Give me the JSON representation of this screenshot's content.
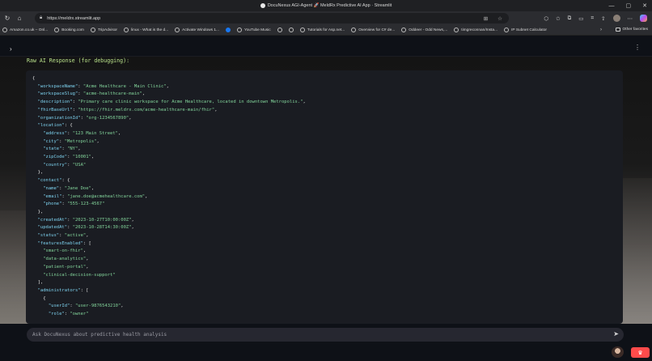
{
  "window": {
    "title": "DocuNexus AGI-Agent 🚀 MeldRx Predictive AI App · Streamlit",
    "controls": [
      "—",
      "▢",
      "✕"
    ]
  },
  "browser": {
    "url": "https://meldrx.streamlit.app",
    "bookmarks": [
      {
        "label": "Amazon.co.uk – Onl...",
        "icon": "amazon-icon"
      },
      {
        "label": "Booking.com",
        "icon": "globe-icon"
      },
      {
        "label": "TripAdvisor",
        "icon": "globe-icon"
      },
      {
        "label": "linux - What is the d...",
        "icon": "globe-icon"
      },
      {
        "label": "Activate Windows 1...",
        "icon": "globe-icon"
      },
      {
        "label": "",
        "icon": "facebook-icon"
      },
      {
        "label": "YouTube Music",
        "icon": "globe-icon"
      },
      {
        "label": "",
        "icon": "globe-icon"
      },
      {
        "label": "",
        "icon": "globe-icon"
      },
      {
        "label": "Tutorials for Asp.net...",
        "icon": "globe-icon"
      },
      {
        "label": "Overview for C# de...",
        "icon": "globe-icon"
      },
      {
        "label": "Oddeer - Odd News,...",
        "icon": "globe-icon"
      },
      {
        "label": "timgreconnan/Insta...",
        "icon": "globe-icon"
      },
      {
        "label": "IP Subnet Calculator",
        "icon": "globe-icon"
      }
    ],
    "other_favorites": "Other favorites"
  },
  "app": {
    "debug_label": "Raw AI Response (for debugging):",
    "chat_placeholder": "Ask DocuNexus about predictive health analysis",
    "json_lines": [
      {
        "indent": 0,
        "key": null,
        "value": "{",
        "punct": ""
      },
      {
        "indent": 1,
        "key": "\"workspaceName\"",
        "value": "\"Acme Healthcare - Main Clinic\"",
        "punct": ","
      },
      {
        "indent": 1,
        "key": "\"workspaceSlug\"",
        "value": "\"acme-healthcare-main\"",
        "punct": ","
      },
      {
        "indent": 1,
        "key": "\"description\"",
        "value": "\"Primary care clinic workspace for Acme Healthcare, located in downtown Metropolis.\"",
        "punct": ","
      },
      {
        "indent": 1,
        "key": "\"fhirBaseUrl\"",
        "value": "\"https://fhir.meldrx.com/acme-healthcare-main/fhir\"",
        "punct": ","
      },
      {
        "indent": 1,
        "key": "\"organizationId\"",
        "value": "\"org-1234567890\"",
        "punct": ","
      },
      {
        "indent": 1,
        "key": "\"location\"",
        "value": "{",
        "punct": ""
      },
      {
        "indent": 2,
        "key": "\"address\"",
        "value": "\"123 Main Street\"",
        "punct": ","
      },
      {
        "indent": 2,
        "key": "\"city\"",
        "value": "\"Metropolis\"",
        "punct": ","
      },
      {
        "indent": 2,
        "key": "\"state\"",
        "value": "\"NY\"",
        "punct": ","
      },
      {
        "indent": 2,
        "key": "\"zipCode\"",
        "value": "\"10001\"",
        "punct": ","
      },
      {
        "indent": 2,
        "key": "\"country\"",
        "value": "\"USA\"",
        "punct": ""
      },
      {
        "indent": 1,
        "key": null,
        "value": "}",
        "punct": ","
      },
      {
        "indent": 1,
        "key": "\"contact\"",
        "value": "{",
        "punct": ""
      },
      {
        "indent": 2,
        "key": "\"name\"",
        "value": "\"Jane Doe\"",
        "punct": ","
      },
      {
        "indent": 2,
        "key": "\"email\"",
        "value": "\"jane.doe@acmehealthcare.com\"",
        "punct": ","
      },
      {
        "indent": 2,
        "key": "\"phone\"",
        "value": "\"555-123-4567\"",
        "punct": ""
      },
      {
        "indent": 1,
        "key": null,
        "value": "}",
        "punct": ","
      },
      {
        "indent": 1,
        "key": "\"createdAt\"",
        "value": "\"2023-10-27T10:00:00Z\"",
        "punct": ","
      },
      {
        "indent": 1,
        "key": "\"updatedAt\"",
        "value": "\"2023-10-28T14:30:00Z\"",
        "punct": ","
      },
      {
        "indent": 1,
        "key": "\"status\"",
        "value": "\"active\"",
        "punct": ","
      },
      {
        "indent": 1,
        "key": "\"featuresEnabled\"",
        "value": "[",
        "punct": ""
      },
      {
        "indent": 2,
        "key": null,
        "value": "\"smart-on-fhir\"",
        "punct": ","
      },
      {
        "indent": 2,
        "key": null,
        "value": "\"data-analytics\"",
        "punct": ","
      },
      {
        "indent": 2,
        "key": null,
        "value": "\"patient-portal\"",
        "punct": ","
      },
      {
        "indent": 2,
        "key": null,
        "value": "\"clinical-decision-support\"",
        "punct": ""
      },
      {
        "indent": 1,
        "key": null,
        "value": "]",
        "punct": ","
      },
      {
        "indent": 1,
        "key": "\"administrators\"",
        "value": "[",
        "punct": ""
      },
      {
        "indent": 2,
        "key": null,
        "value": "{",
        "punct": ""
      },
      {
        "indent": 3,
        "key": "\"userId\"",
        "value": "\"user-9876543210\"",
        "punct": ","
      },
      {
        "indent": 3,
        "key": "\"role\"",
        "value": "\"owner\"",
        "punct": ""
      }
    ]
  },
  "colors": {
    "accent_green": "#b9e28a",
    "json_key": "#7ed3f0",
    "json_string": "#82d39a",
    "streamlit_red": "#ff4b4b"
  }
}
